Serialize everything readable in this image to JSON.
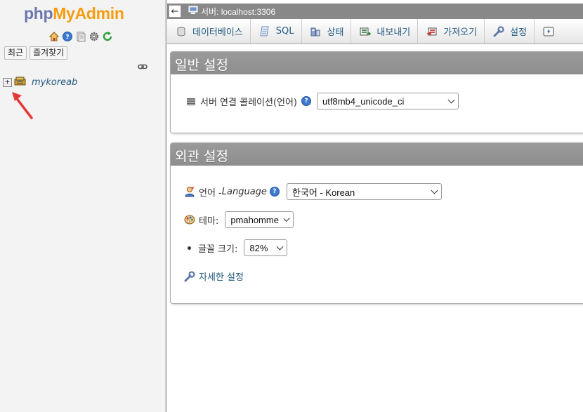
{
  "nav": {
    "logo_php": "php",
    "logo_myadmin": "MyAdmin",
    "icons": [
      "home-icon",
      "help-icon",
      "docs-icon",
      "settings-icon",
      "reload-icon"
    ],
    "recent_label": "최근",
    "favorites_label": "즐겨찾기",
    "tree": [
      {
        "expander": "+",
        "name": "mykoreab"
      }
    ]
  },
  "server_bar": {
    "back": "←",
    "label": "서버: localhost:3306"
  },
  "tabs": [
    {
      "label": "데이터베이스",
      "icon": "database-icon"
    },
    {
      "label": "SQL",
      "icon": "sql-icon"
    },
    {
      "label": "상태",
      "icon": "status-icon"
    },
    {
      "label": "내보내기",
      "icon": "export-icon"
    },
    {
      "label": "가져오기",
      "icon": "import-icon"
    },
    {
      "label": "설정",
      "icon": "wrench-icon"
    }
  ],
  "general": {
    "title": "일반 설정",
    "collation_label": "서버 연결 콜레이션(언어)",
    "collation_value": "utf8mb4_unicode_ci"
  },
  "appearance": {
    "title": "외관 설정",
    "language_label": "언어 - ",
    "language_label_en": "Language",
    "language_value": "한국어 - Korean",
    "theme_label": "테마:",
    "theme_value": "pmahomme",
    "font_size_label": "글꼴 크기:",
    "font_size_value": "82%",
    "more_settings": "자세한 설정"
  },
  "colors": {
    "accent_link": "#235a81",
    "panel_header": "#8e8e8e",
    "logo_php": "#6c78af",
    "logo_myadmin": "#f89c0e",
    "arrow": "#e53935"
  }
}
